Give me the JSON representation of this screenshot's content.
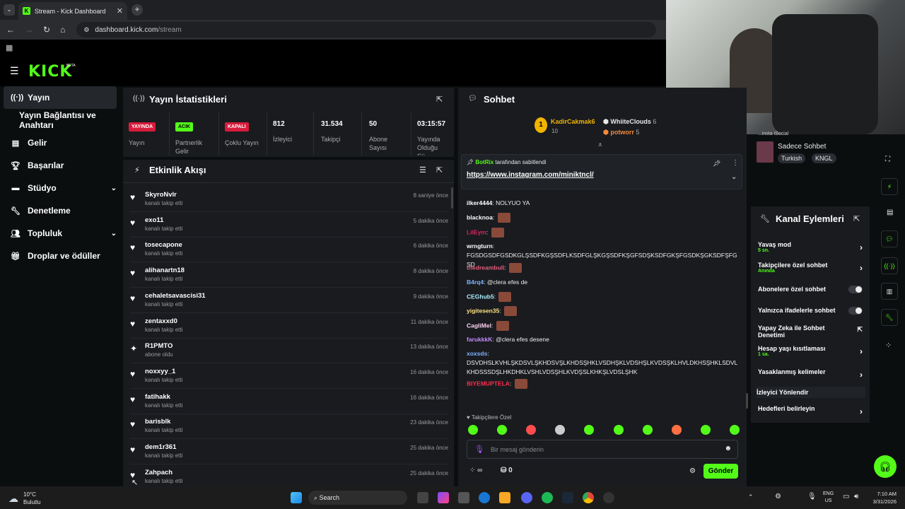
{
  "browser": {
    "tab_title": "Stream - Kick Dashboard",
    "url_domain": "dashboard.kick.com",
    "url_path": "/stream"
  },
  "brand": {
    "logo": "KICK",
    "beta": "BETA",
    "accent": "#53fc18"
  },
  "sidebar": [
    {
      "label": "Yayın",
      "icon": "broadcast-icon",
      "active": true
    },
    {
      "label": "Yayın Bağlantısı ve Anahtarı",
      "icon": ""
    },
    {
      "label": "Gelir",
      "icon": "chart-icon"
    },
    {
      "label": "Başarılar",
      "icon": "trophy-icon"
    },
    {
      "label": "Stüdyo",
      "icon": "studio-icon",
      "chev": "⌄"
    },
    {
      "label": "Denetleme",
      "icon": "wrench-icon"
    },
    {
      "label": "Topluluk",
      "icon": "people-icon",
      "chev": "⌄"
    },
    {
      "label": "Droplar ve ödüller",
      "icon": "gift-icon"
    }
  ],
  "stats": {
    "title": "Yayın İstatistikleri",
    "items": [
      {
        "badge": "YAYINDA",
        "badge_color": "#d81b3c",
        "label": "Yayın"
      },
      {
        "badge": "ACIK",
        "badge_color": "#53fc18",
        "label": "Partnerlik Gelir"
      },
      {
        "badge": "KAPALI",
        "badge_color": "#d81b3c",
        "label": "Çoklu Yayın"
      },
      {
        "value": "812",
        "label": "İzleyici"
      },
      {
        "value": "31.534",
        "label": "Takipçi"
      },
      {
        "value": "50",
        "label": "Abone Sayısı"
      },
      {
        "value": "03:15:57",
        "label": "Yayında Olduğu Sü..."
      }
    ]
  },
  "activity": {
    "title": "Etkinlik Akışı",
    "items": [
      {
        "name": "SkyroNvlr",
        "sub": "kanalı takip etti",
        "time": "8 saniye önce"
      },
      {
        "name": "exo11",
        "sub": "kanalı takip etti",
        "time": "5 dakika önce"
      },
      {
        "name": "tosecapone",
        "sub": "kanalı takip etti",
        "time": "6 dakika önce"
      },
      {
        "name": "alihanartn18",
        "sub": "kanalı takip etti",
        "time": "8 dakika önce"
      },
      {
        "name": "cehaletsavascisi31",
        "sub": "kanalı takip etti",
        "time": "9 dakika önce"
      },
      {
        "name": "zentaxxd0",
        "sub": "kanalı takip etti",
        "time": "11 dakika önce"
      },
      {
        "name": "R1PMTO",
        "sub": "abone oldu",
        "time": "13 dakika önce"
      },
      {
        "name": "noxxyy_1",
        "sub": "kanalı takip etti",
        "time": "16 dakika önce"
      },
      {
        "name": "fatihakk",
        "sub": "kanalı takip etti",
        "time": "16 dakika önce"
      },
      {
        "name": "barisblk",
        "sub": "kanalı takip etti",
        "time": "23 dakika önce"
      },
      {
        "name": "dem1r361",
        "sub": "kanalı takip etti",
        "time": "25 dakika önce"
      },
      {
        "name": "Zahpach",
        "sub": "kanalı takip etti",
        "time": "25 dakika önce"
      }
    ]
  },
  "chat": {
    "title": "Sohbet",
    "top": {
      "rank1": "KadirCakmak6",
      "rank1_sub": "10",
      "user2": "WhiiteClouds",
      "user2_val": "6",
      "user3": "potworr",
      "user3_val": "5"
    },
    "pinned": {
      "by": "BotRix",
      "by_text": "tarafından sabitlendi",
      "link": "https://www.instagram.com/miniktncl/"
    },
    "messages": [
      {
        "user": "ilker4444",
        "color": "#ffffff",
        "text": "NOLYUO YA"
      },
      {
        "user": "blacknoa",
        "color": "#ffffff",
        "text": "",
        "emote": true
      },
      {
        "user": "LilEym",
        "color": "#e0245e",
        "text": "",
        "emote": true
      },
      {
        "user": "wrngturn",
        "color": "#ffffff",
        "text": "FGSDGSDFGSDKGLŞSDFKGŞSDFLKSDFGLŞKGŞSDFKŞGFSDŞKSDFGKŞFGSDKŞGKSDFŞFGSD"
      },
      {
        "user": "thedreambull",
        "color": "#e65c7b",
        "text": "",
        "emote": true
      },
      {
        "user": "B4rq4",
        "color": "#7fb3ff",
        "text": "@clera efes de"
      },
      {
        "user": "CEGhub5",
        "color": "#aef0ff",
        "text": "",
        "emote": true
      },
      {
        "user": "yigitesen35",
        "color": "#ffe27f",
        "text": "",
        "emote": true
      },
      {
        "user": "CagliMel",
        "color": "#ffd3f2",
        "text": "",
        "emote": true
      },
      {
        "user": "farukkkK",
        "color": "#c68cff",
        "text": "@clera efes desene"
      },
      {
        "user": "xoxsds",
        "color": "#7fb3ff",
        "text": "DSVDHSLKVHLŞKDSVLŞKHDSVŞLKHDSŞHKLVSDHŞKLVDSHŞLKVDSŞKLHVLDKHSŞHKLSDVLKHDSSSDŞLHKDHKLVSHLVDSŞHLKVDŞSLKHKŞLVDSLŞHK"
      },
      {
        "user": "BIYEMUPTELA",
        "color": "#ff2e4d",
        "text": "",
        "emote": true
      }
    ],
    "followers_only": "Takipçilere Özel",
    "input_placeholder": "Bir mesaj gönderin",
    "send": "Gönder",
    "points": "0"
  },
  "channel_info": {
    "title": "Sadece Sohbet",
    "tags": [
      "Turkish",
      "KNGL"
    ],
    "partial": "...insta iSocial"
  },
  "actions": {
    "title": "Kanal Eylemleri",
    "items": [
      {
        "label": "Yavaş mod",
        "sub": "5 sn.",
        "type": "chev"
      },
      {
        "label": "Takipçilere özel sohbet",
        "sub": "Anında",
        "type": "chev"
      },
      {
        "label": "Abonelere özel sohbet",
        "sub": "",
        "type": "toggle"
      },
      {
        "label": "Yalnızca ifadelerle sohbet",
        "sub": "",
        "type": "toggle"
      },
      {
        "label": "Yapay Zeka ile Sohbet Denetimi",
        "sub": "",
        "type": "ext"
      },
      {
        "label": "Hesap yaşı kısıtlaması",
        "sub": "1 sa.",
        "type": "chev"
      },
      {
        "label": "Yasaklanmış kelimeler",
        "sub": "",
        "type": "chev"
      },
      {
        "label": "İzleyici Yönlendir",
        "sub": "",
        "type": "none"
      },
      {
        "label": "Hedefleri belirleyin",
        "sub": "",
        "type": "chev"
      }
    ]
  },
  "taskbar": {
    "temp": "10°C",
    "weather": "Bulutlu",
    "search": "Search",
    "lang1": "ENG",
    "lang2": "US",
    "time": "7:10 AM",
    "date": "3/31/2026"
  }
}
